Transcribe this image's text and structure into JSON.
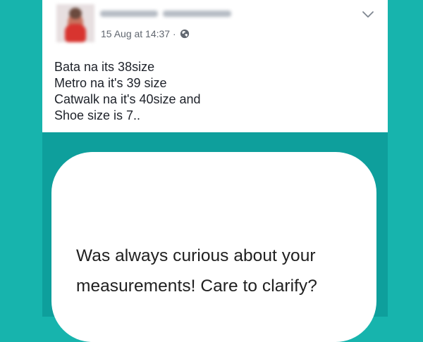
{
  "post": {
    "timestamp": "15 Aug at 14:37",
    "lines": [
      "Bata na its 38size",
      "Metro na it's 39 size",
      "Catwalk na it's 40size and",
      "Shoe size is 7.."
    ],
    "separator": "·",
    "icons": {
      "privacy": "globe-icon",
      "menu": "chevron-down-icon"
    }
  },
  "question": {
    "lines": [
      "Was always curious about your",
      "measurements! Care to clarify?"
    ]
  },
  "colors": {
    "background": "#17b4ad",
    "panel": "#0e9f9c",
    "card": "#ffffff",
    "meta_text": "#616770",
    "body_text": "#1d2129"
  }
}
